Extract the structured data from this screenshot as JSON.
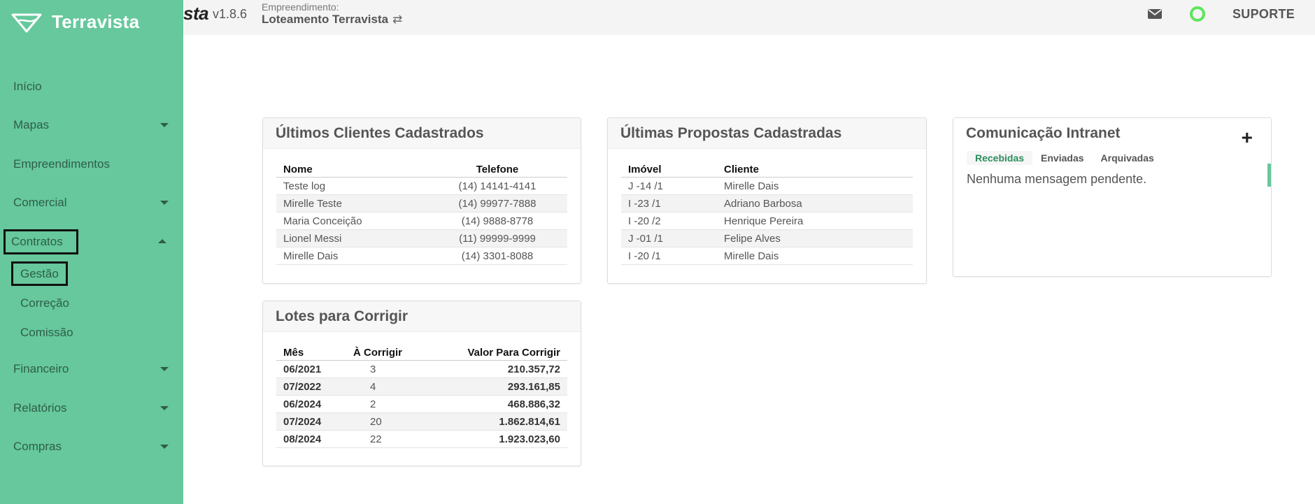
{
  "header": {
    "brand_tail": "sta",
    "version": "v1.8.6",
    "empreendimento_label": "Empreendimento:",
    "empreendimento_name": "Loteamento Terravista",
    "suporte_label": "SUPORTE",
    "status_color": "#5ce65c"
  },
  "sidebar": {
    "brand": "Terravista",
    "items": [
      {
        "label": "Início",
        "has_caret": false
      },
      {
        "label": "Mapas",
        "has_caret": true
      },
      {
        "label": "Empreendimentos",
        "has_caret": false
      },
      {
        "label": "Comercial",
        "has_caret": true
      },
      {
        "label": "Contratos",
        "has_caret": true,
        "expanded": true
      },
      {
        "label": "Financeiro",
        "has_caret": true
      },
      {
        "label": "Relatórios",
        "has_caret": true
      },
      {
        "label": "Compras",
        "has_caret": true
      }
    ],
    "contratos_sub": [
      {
        "label": "Gestão"
      },
      {
        "label": "Correção"
      },
      {
        "label": "Comissão"
      }
    ],
    "accent_color": "#66c89c"
  },
  "clientes": {
    "title": "Últimos Clientes Cadastrados",
    "headers": [
      "Nome",
      "Telefone"
    ],
    "rows": [
      [
        "Teste log",
        "(14) 14141-4141"
      ],
      [
        "Mirelle Teste",
        "(14) 99977-7888"
      ],
      [
        "Maria Conceição",
        "(14) 9888-8778"
      ],
      [
        "Lionel Messi",
        "(11) 99999-9999"
      ],
      [
        "Mirelle Dais",
        "(14) 3301-8088"
      ]
    ]
  },
  "propostas": {
    "title": "Últimas Propostas Cadastradas",
    "headers": [
      "Imóvel",
      "Cliente"
    ],
    "rows": [
      [
        "J -14 /1",
        "Mirelle Dais"
      ],
      [
        "I -23 /1",
        "Adriano Barbosa"
      ],
      [
        "I -20 /2",
        "Henrique Pereira"
      ],
      [
        "J -01 /1",
        "Felipe Alves"
      ],
      [
        "I -20 /1",
        "Mirelle Dais"
      ]
    ]
  },
  "intranet": {
    "title": "Comunicação Intranet",
    "tabs": [
      "Recebidas",
      "Enviadas",
      "Arquivadas"
    ],
    "active_tab": "Recebidas",
    "empty_message": "Nenhuma mensagem pendente."
  },
  "lotes": {
    "title": "Lotes para Corrigir",
    "headers": [
      "Mês",
      "À Corrigir",
      "Valor Para Corrigir"
    ],
    "rows": [
      [
        "06/2021",
        "3",
        "210.357,72"
      ],
      [
        "07/2022",
        "4",
        "293.161,85"
      ],
      [
        "06/2024",
        "2",
        "468.886,32"
      ],
      [
        "07/2024",
        "20",
        "1.862.814,61"
      ],
      [
        "08/2024",
        "22",
        "1.923.023,60"
      ]
    ]
  }
}
